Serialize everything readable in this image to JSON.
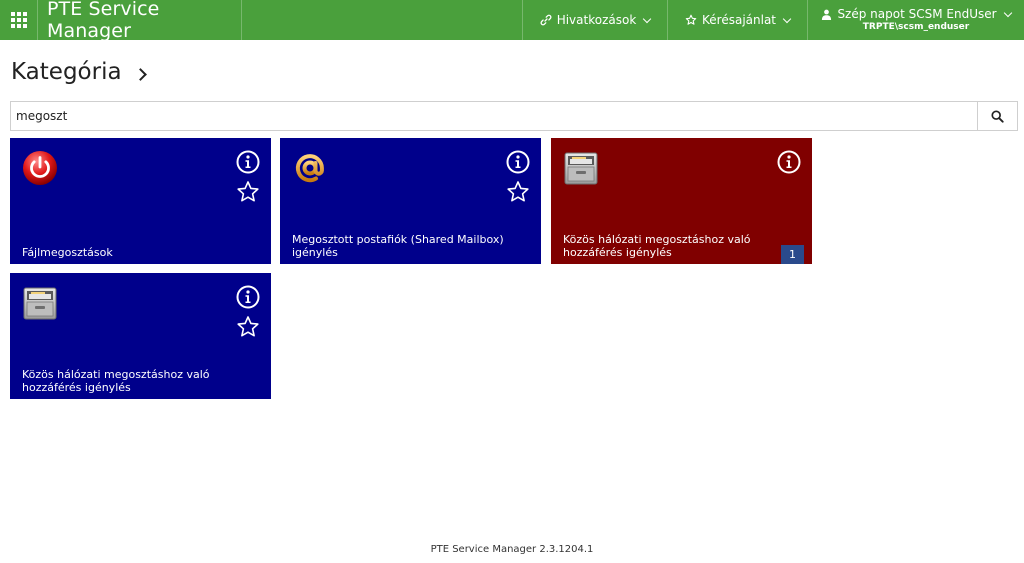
{
  "header": {
    "brand": "PTE Service Manager",
    "links_label": "Hivatkozások",
    "request_label": "Kérésajánlat",
    "user_greeting": "Szép napot SCSM EndUser",
    "user_account": "TRPTE\\scsm_enduser",
    "bar_color": "#4aa03c"
  },
  "page": {
    "title": "Kategória"
  },
  "search": {
    "value": "megoszt"
  },
  "tiles": [
    {
      "label": "Fájlmegosztások",
      "color": "#00008b",
      "icon": "power-icon",
      "favorite": true
    },
    {
      "label": "Megosztott postafiók (Shared Mailbox) igénylés",
      "color": "#00008b",
      "icon": "at-sign-icon",
      "favorite": true
    },
    {
      "label": "Közös hálózati megosztáshoz való hozzáférés igénylés",
      "color": "#800000",
      "icon": "file-cabinet-icon",
      "favorite": false,
      "badge": "1"
    },
    {
      "label": "Közös hálózati megosztáshoz való hozzáférés igénylés",
      "color": "#00008b",
      "icon": "file-cabinet-icon",
      "favorite": true
    }
  ],
  "footer": {
    "version": "PTE Service Manager 2.3.1204.1"
  }
}
